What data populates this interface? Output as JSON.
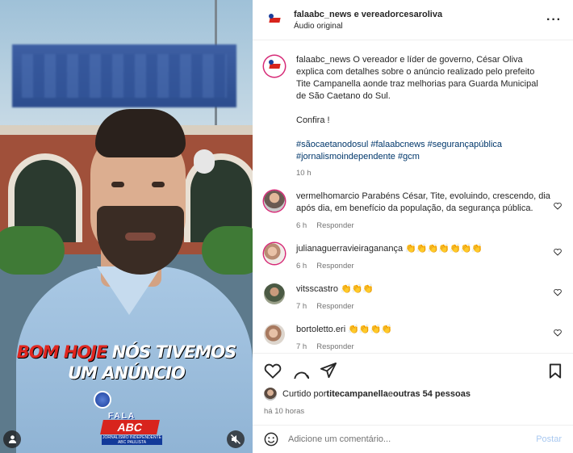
{
  "video": {
    "caption_red": "BOM HOJE ",
    "caption_white": "NÓS TIVEMOS",
    "caption_line2": "UM ANÚNCIO",
    "logo_fala": "FALA",
    "logo_abc": "ABC",
    "logo_sub": "JORNALISMO INDEPENDENTE ABC PAULISTA",
    "user_icon": "person-icon",
    "mute_icon": "muted-speaker-icon"
  },
  "header": {
    "title": "falaabc_news e vereadorcesaroliva",
    "subtitle": "Áudio original",
    "more": "···"
  },
  "caption": {
    "username": "falaabc_news",
    "text": "O vereador e líder de governo, César Oliva explica com detalhes sobre o anúncio realizado pelo prefeito Tite Campanella aonde traz melhorias para Guarda Municipal de São Caetano do Sul.",
    "confira": "Confira !",
    "hashtags_line1": "#sãocaetanodosul #falaabcnews #segurançapública",
    "hashtags_line2": "#jornalismoindependente #gcm",
    "time": "10 h"
  },
  "comments": [
    {
      "username": "vermelhomarcio",
      "text": "Parabéns César, Tite, evoluindo, crescendo, dia após dia, em benefício da população, da segurança pública.",
      "time": "6 h",
      "reply": "Responder"
    },
    {
      "username": "julianaguerravieiraganança",
      "text": "👏👏👏👏👏👏👏",
      "time": "6 h",
      "reply": "Responder"
    },
    {
      "username": "vitsscastro",
      "text": "👏👏👏",
      "time": "7 h",
      "reply": "Responder"
    },
    {
      "username": "bortoletto.eri",
      "text": "👏👏👏👏",
      "time": "7 h",
      "reply": "Responder"
    }
  ],
  "likes": {
    "prefix": "Curtido por ",
    "user": "titecampanella",
    "middle": " e ",
    "others": "outras 54 pessoas",
    "time": "há 10 horas"
  },
  "composer": {
    "placeholder": "Adicione um comentário...",
    "post": "Postar"
  },
  "colors": {
    "link": "#00376b",
    "muted": "#737373",
    "accent_red": "#d8241d",
    "accent_blue": "#1a3e9c",
    "post_disabled": "#a8c8f0"
  }
}
